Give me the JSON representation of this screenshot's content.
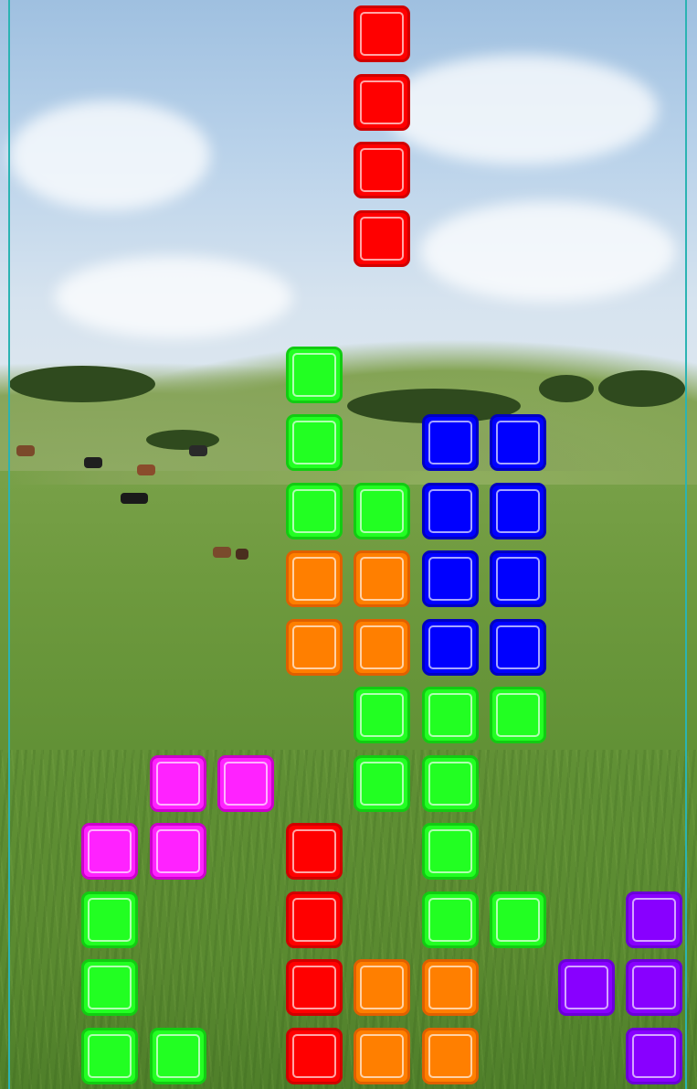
{
  "game": {
    "colors": {
      "red": "#ff0000",
      "red_edge": "#d00000",
      "green": "#22ff22",
      "green_edge": "#12cc12",
      "blue": "#0000ff",
      "blue_edge": "#0000c0",
      "orange": "#ff7f00",
      "orange_edge": "#e06000",
      "magenta": "#ff22ff",
      "magenta_edge": "#cc00cc",
      "purple": "#8800ff",
      "purple_edge": "#6a00d8",
      "well_border": "#2bb3b3"
    },
    "falling_piece": {
      "name": "falling-i-piece",
      "color": "red",
      "cells": [
        [
          5,
          0
        ],
        [
          5,
          1
        ],
        [
          5,
          2
        ],
        [
          5,
          3
        ]
      ]
    },
    "board_cells": [
      {
        "col": 4,
        "row": 5,
        "color": "green"
      },
      {
        "col": 4,
        "row": 6,
        "color": "green"
      },
      {
        "col": 4,
        "row": 7,
        "color": "green"
      },
      {
        "col": 5,
        "row": 7,
        "color": "green"
      },
      {
        "col": 6,
        "row": 6,
        "color": "blue"
      },
      {
        "col": 7,
        "row": 6,
        "color": "blue"
      },
      {
        "col": 6,
        "row": 7,
        "color": "blue"
      },
      {
        "col": 7,
        "row": 7,
        "color": "blue"
      },
      {
        "col": 4,
        "row": 8,
        "color": "orange"
      },
      {
        "col": 5,
        "row": 8,
        "color": "orange"
      },
      {
        "col": 6,
        "row": 8,
        "color": "blue"
      },
      {
        "col": 7,
        "row": 8,
        "color": "blue"
      },
      {
        "col": 4,
        "row": 9,
        "color": "orange"
      },
      {
        "col": 5,
        "row": 9,
        "color": "orange"
      },
      {
        "col": 6,
        "row": 9,
        "color": "blue"
      },
      {
        "col": 7,
        "row": 9,
        "color": "blue"
      },
      {
        "col": 5,
        "row": 10,
        "color": "green"
      },
      {
        "col": 6,
        "row": 10,
        "color": "green"
      },
      {
        "col": 7,
        "row": 10,
        "color": "green"
      },
      {
        "col": 2,
        "row": 11,
        "color": "magenta"
      },
      {
        "col": 3,
        "row": 11,
        "color": "magenta"
      },
      {
        "col": 5,
        "row": 11,
        "color": "green"
      },
      {
        "col": 6,
        "row": 11,
        "color": "green"
      },
      {
        "col": 1,
        "row": 12,
        "color": "magenta"
      },
      {
        "col": 2,
        "row": 12,
        "color": "magenta"
      },
      {
        "col": 4,
        "row": 12,
        "color": "red"
      },
      {
        "col": 6,
        "row": 12,
        "color": "green"
      },
      {
        "col": 1,
        "row": 13,
        "color": "green"
      },
      {
        "col": 4,
        "row": 13,
        "color": "red"
      },
      {
        "col": 6,
        "row": 13,
        "color": "green"
      },
      {
        "col": 7,
        "row": 13,
        "color": "green"
      },
      {
        "col": 9,
        "row": 13,
        "color": "purple"
      },
      {
        "col": 1,
        "row": 14,
        "color": "green"
      },
      {
        "col": 4,
        "row": 14,
        "color": "red"
      },
      {
        "col": 5,
        "row": 14,
        "color": "orange"
      },
      {
        "col": 6,
        "row": 14,
        "color": "orange"
      },
      {
        "col": 8,
        "row": 14,
        "color": "purple"
      },
      {
        "col": 9,
        "row": 14,
        "color": "purple"
      },
      {
        "col": 1,
        "row": 15,
        "color": "green"
      },
      {
        "col": 2,
        "row": 15,
        "color": "green"
      },
      {
        "col": 4,
        "row": 15,
        "color": "red"
      },
      {
        "col": 5,
        "row": 15,
        "color": "orange"
      },
      {
        "col": 6,
        "row": 15,
        "color": "orange"
      },
      {
        "col": 9,
        "row": 15,
        "color": "purple"
      }
    ]
  }
}
